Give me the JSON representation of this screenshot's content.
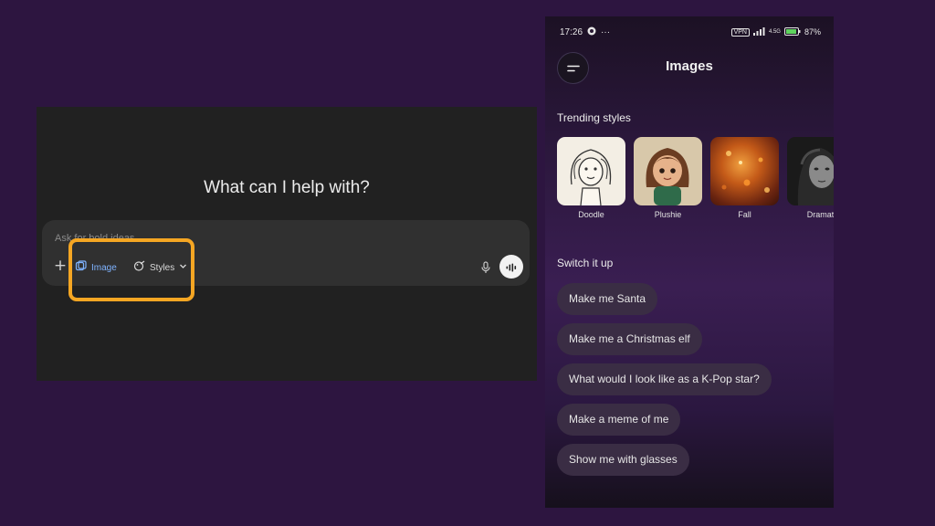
{
  "desktop": {
    "heading": "What can I help with?",
    "composer_placeholder": "Ask for bold ideas",
    "tools": {
      "image_label": "Image",
      "styles_label": "Styles"
    },
    "icons": [
      "plus-icon",
      "image-icon",
      "palette-icon",
      "chevron-down-icon",
      "mic-icon",
      "voice-waveform-icon"
    ],
    "colors": {
      "highlight": "#f5a623",
      "image_tool": "#7fb3ff"
    }
  },
  "phone": {
    "status": {
      "time": "17:26",
      "vpn": "VPN",
      "network": "4.5G",
      "battery": "87%"
    },
    "title": "Images",
    "trending_label": "Trending styles",
    "trending": [
      {
        "label": "Doodle"
      },
      {
        "label": "Plushie"
      },
      {
        "label": "Fall"
      },
      {
        "label": "Dramati"
      }
    ],
    "switch_label": "Switch it up",
    "suggestions": [
      "Make me Santa",
      "Make me a Christmas elf",
      "What would I look like as a K-Pop star?",
      "Make a meme of me",
      "Show me with glasses"
    ]
  }
}
